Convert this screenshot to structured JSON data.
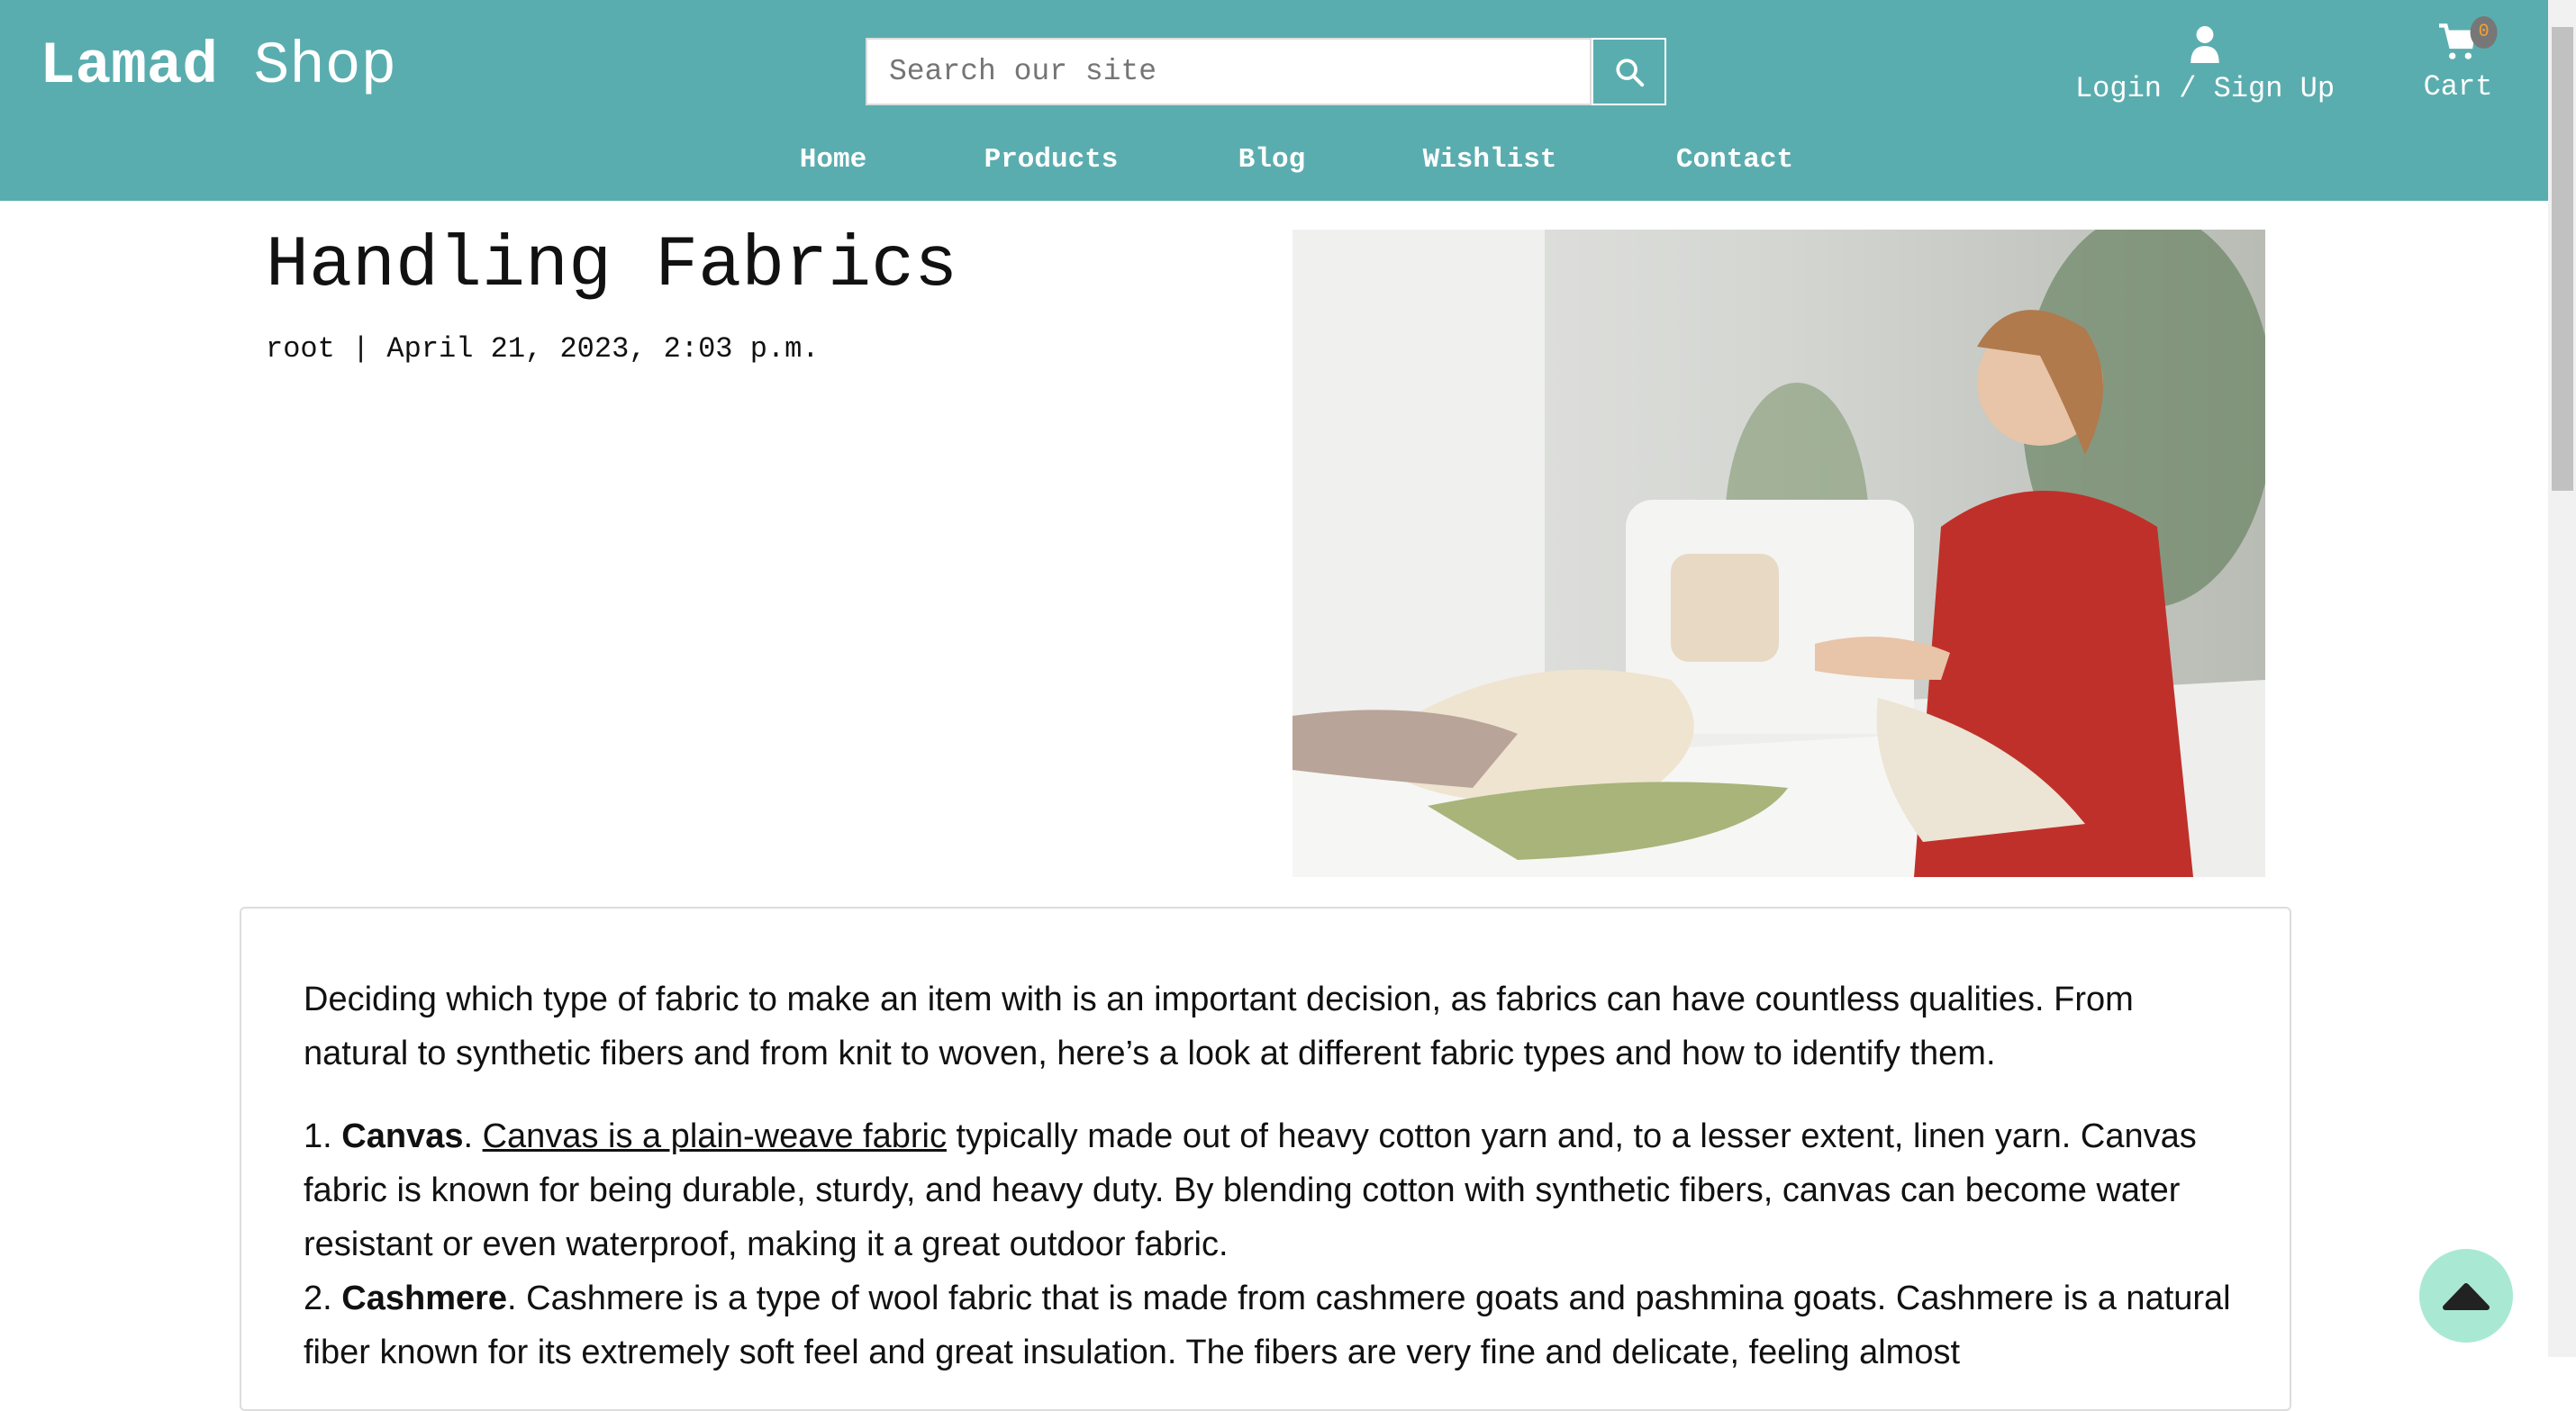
{
  "header": {
    "logo_bold": "Lamad",
    "logo_rest": "Shop",
    "search_placeholder": "Search our site",
    "login_label": "Login / Sign Up",
    "cart_label": "Cart",
    "cart_count": "0"
  },
  "nav": [
    "Home",
    "Products",
    "Blog",
    "Wishlist",
    "Contact"
  ],
  "post": {
    "title": "Handling Fabrics",
    "author": "root",
    "separator": "|",
    "date": "April 21, 2023, 2:03 p.m."
  },
  "content": {
    "intro": "Deciding which type of fabric to make an item with is an important decision, as fabrics can have countless qualities. From natural to synthetic fibers and from knit to woven, here’s a look at different fabric types and how to identify them.",
    "items": [
      {
        "num": "1.",
        "name": "Canvas",
        "link": "Canvas is a plain-weave fabric",
        "text": " typically made out of heavy cotton yarn and, to a lesser extent, linen yarn. Canvas fabric is known for being durable, sturdy, and heavy duty. By blending cotton with synthetic fibers, canvas can become water resistant or even waterproof, making it a great outdoor fabric."
      },
      {
        "num": "2.",
        "name": "Cashmere",
        "text": "Cashmere is a type of wool fabric that is made from cashmere goats and pashmina goats. Cashmere is a natural fiber known for its extremely soft feel and great insulation. The fibers are very fine and delicate, feeling almost"
      }
    ]
  }
}
